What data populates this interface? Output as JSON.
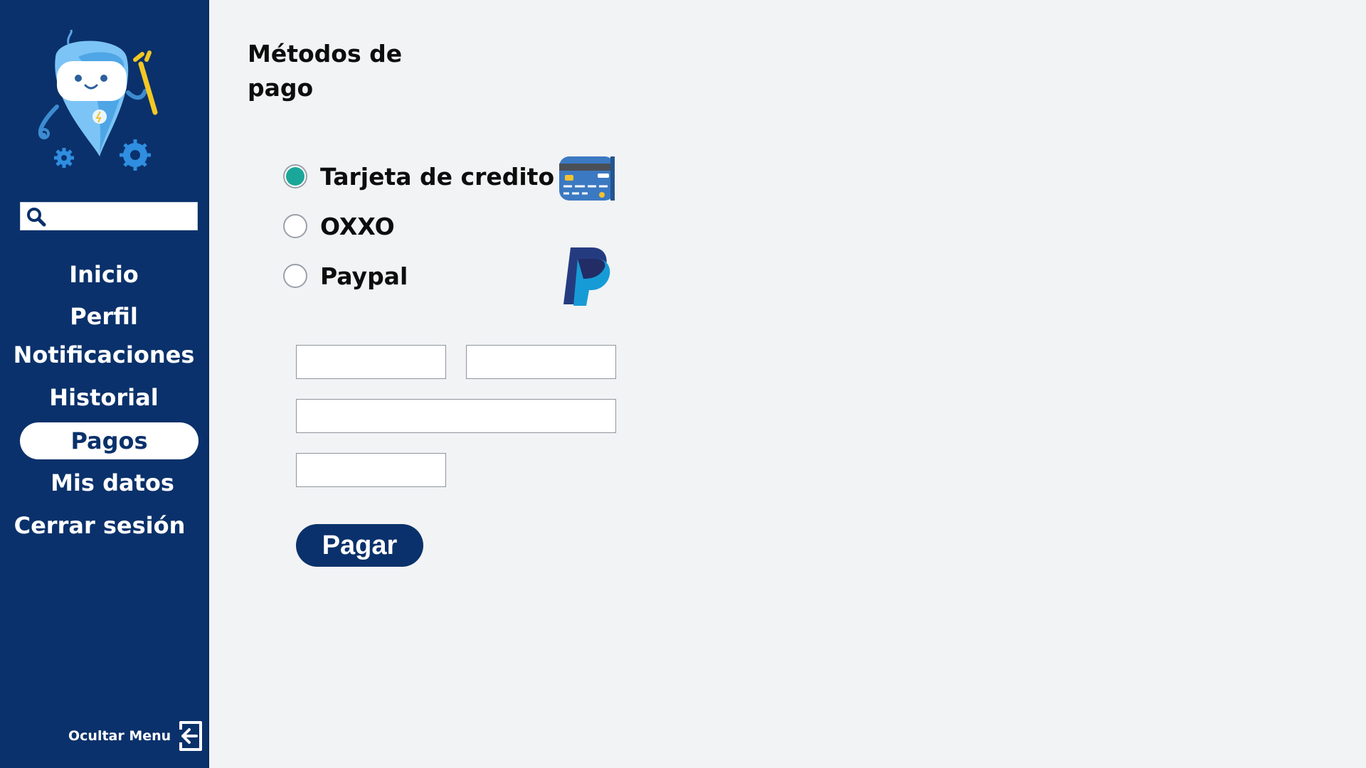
{
  "sidebar": {
    "search": {
      "placeholder": ""
    },
    "items": [
      {
        "label": "Inicio"
      },
      {
        "label": "Perfil"
      },
      {
        "label": "Notificaciones"
      },
      {
        "label": "Historial"
      },
      {
        "label": "Pagos",
        "active": true
      },
      {
        "label": "Mis datos"
      },
      {
        "label": "Cerrar sesión"
      }
    ],
    "hide_menu_label": "Ocultar Menu"
  },
  "main": {
    "title": "Métodos de pago",
    "methods": [
      {
        "label": "Tarjeta de credito",
        "selected": true,
        "icon": "credit-card-icon"
      },
      {
        "label": "OXXO",
        "selected": false
      },
      {
        "label": "Paypal",
        "selected": false,
        "icon": "paypal-icon"
      }
    ],
    "form": {
      "field_1": "",
      "field_2": "",
      "field_3": "",
      "field_4": ""
    },
    "pay_button_label": "Pagar"
  },
  "colors": {
    "sidebar_bg": "#0a316b",
    "accent_radio": "#1aa79a",
    "page_bg": "#f2f3f5"
  }
}
